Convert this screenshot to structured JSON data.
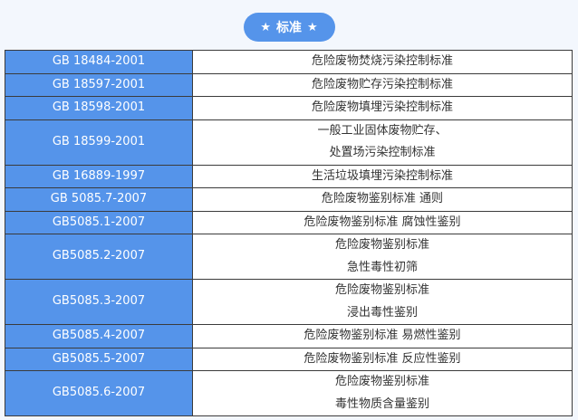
{
  "header": {
    "star_left": "★",
    "title": "标准",
    "star_right": "★"
  },
  "colors": {
    "accent": "#5594ea",
    "background": "#f3f7fd",
    "border": "#3b3b3b",
    "text": "#333333"
  },
  "table": {
    "rows": [
      {
        "code": "GB 18484-2001",
        "lines": [
          "危险废物焚烧污染控制标准"
        ]
      },
      {
        "code": "GB 18597-2001",
        "lines": [
          "危险废物贮存污染控制标准"
        ]
      },
      {
        "code": "GB 18598-2001",
        "lines": [
          "危险废物填埋污染控制标准"
        ]
      },
      {
        "code": "GB 18599-2001",
        "lines": [
          "一般工业固体废物贮存、",
          "处置场污染控制标准"
        ]
      },
      {
        "code": "GB 16889-1997",
        "lines": [
          "生活垃圾填埋污染控制标准"
        ]
      },
      {
        "code": "GB 5085.7-2007",
        "lines": [
          "危险废物鉴别标准 通则"
        ]
      },
      {
        "code": "GB5085.1-2007",
        "lines": [
          "危险废物鉴别标准 腐蚀性鉴别"
        ]
      },
      {
        "code": "GB5085.2-2007",
        "lines": [
          "危险废物鉴别标准",
          "急性毒性初筛"
        ]
      },
      {
        "code": "GB5085.3-2007",
        "lines": [
          "危险废物鉴别标准",
          "浸出毒性鉴别"
        ]
      },
      {
        "code": "GB5085.4-2007",
        "lines": [
          "危险废物鉴别标准 易燃性鉴别"
        ]
      },
      {
        "code": "GB5085.5-2007",
        "lines": [
          "危险废物鉴别标准 反应性鉴别"
        ]
      },
      {
        "code": "GB5085.6-2007",
        "lines": [
          "危险废物鉴别标准",
          "毒性物质含量鉴别"
        ]
      }
    ]
  }
}
